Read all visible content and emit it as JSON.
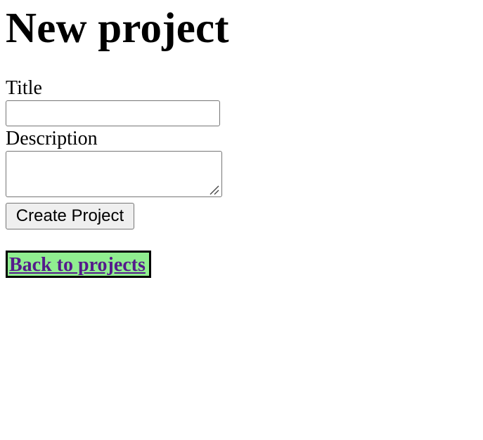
{
  "page": {
    "heading": "New project"
  },
  "form": {
    "title_label": "Title",
    "title_value": "",
    "description_label": "Description",
    "description_value": "",
    "submit_label": "Create Project"
  },
  "nav": {
    "back_link": "Back to projects"
  },
  "colors": {
    "link": "#551a8b",
    "link_highlight_bg": "#90ee90",
    "button_bg": "#efefef",
    "input_border": "#767676"
  }
}
